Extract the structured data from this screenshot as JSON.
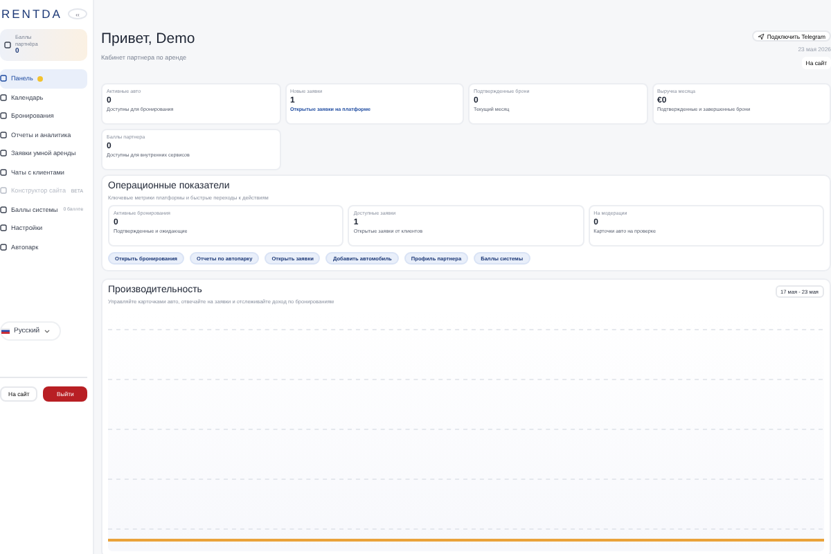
{
  "sidebar": {
    "logo": "RENTDA",
    "collapse": "‹‹",
    "balance": {
      "label": "Баллы партнёра",
      "value": "0"
    },
    "items": [
      {
        "label": "Панель",
        "selected": true,
        "disabled": false,
        "badge": true
      },
      {
        "label": "Календарь",
        "selected": false,
        "disabled": false
      },
      {
        "label": "Бронирования",
        "selected": false,
        "disabled": false
      },
      {
        "label": "Отчеты и аналитика",
        "selected": false,
        "disabled": false
      },
      {
        "label": "Заявки умной аренды",
        "selected": false,
        "disabled": false
      },
      {
        "label": "Чаты с клиентами",
        "selected": false,
        "disabled": false
      },
      {
        "label": "Конструктор сайта",
        "selected": false,
        "disabled": true,
        "tag": "BETA"
      },
      {
        "label": "Баллы системы",
        "selected": false,
        "disabled": false,
        "tag": "0 баллов"
      },
      {
        "label": "Настройки",
        "selected": false,
        "disabled": false
      },
      {
        "label": "Автопарк",
        "selected": false,
        "disabled": false
      }
    ],
    "language": "Русский",
    "site_button": "На сайт",
    "logout_button": "Выйти"
  },
  "header": {
    "title": "Привет, Demo",
    "subtitle": "Кабинет партнера по аренде",
    "telegram_button": "Подключить Telegram",
    "date": "23 мая 2026",
    "site_button": "На сайт"
  },
  "stats": [
    {
      "label": "Активные авто",
      "value": "0",
      "note": "Доступны для бронирования",
      "link": false
    },
    {
      "label": "Новые заявки",
      "value": "1",
      "note": "Открытые заявки на платформе",
      "link": true
    },
    {
      "label": "Подтвержденные брони",
      "value": "0",
      "note": "Текущий месяц",
      "link": false
    },
    {
      "label": "Выручка месяца",
      "value": "€0",
      "note": "Подтвержденные и завершенные брони",
      "link": false
    },
    {
      "label": "Баллы партнера",
      "value": "0",
      "note": "Доступны для внутренних сервисов",
      "link": false
    }
  ],
  "operations": {
    "title": "Операционные показатели",
    "subtitle": "Ключевые метрики платформы и быстрые переходы к действиям",
    "metrics": [
      {
        "label": "Активные бронирования",
        "value": "0",
        "note": "Подтвержденные и ожидающие"
      },
      {
        "label": "Доступные заявки",
        "value": "1",
        "note": "Открытые заявки от клиентов"
      },
      {
        "label": "На модерации",
        "value": "0",
        "note": "Карточки авто на проверке"
      }
    ],
    "actions": [
      "Открыть бронирования",
      "Отчеты по автопарку",
      "Открыть заявки",
      "Добавить автомобиль",
      "Профиль партнера",
      "Баллы системы"
    ]
  },
  "performance": {
    "title": "Производительность",
    "subtitle": "Управляйте карточками авто, отвечайте на заявки и отслеживайте доход по бронированиям",
    "range": "17 мая - 23 мая"
  }
}
